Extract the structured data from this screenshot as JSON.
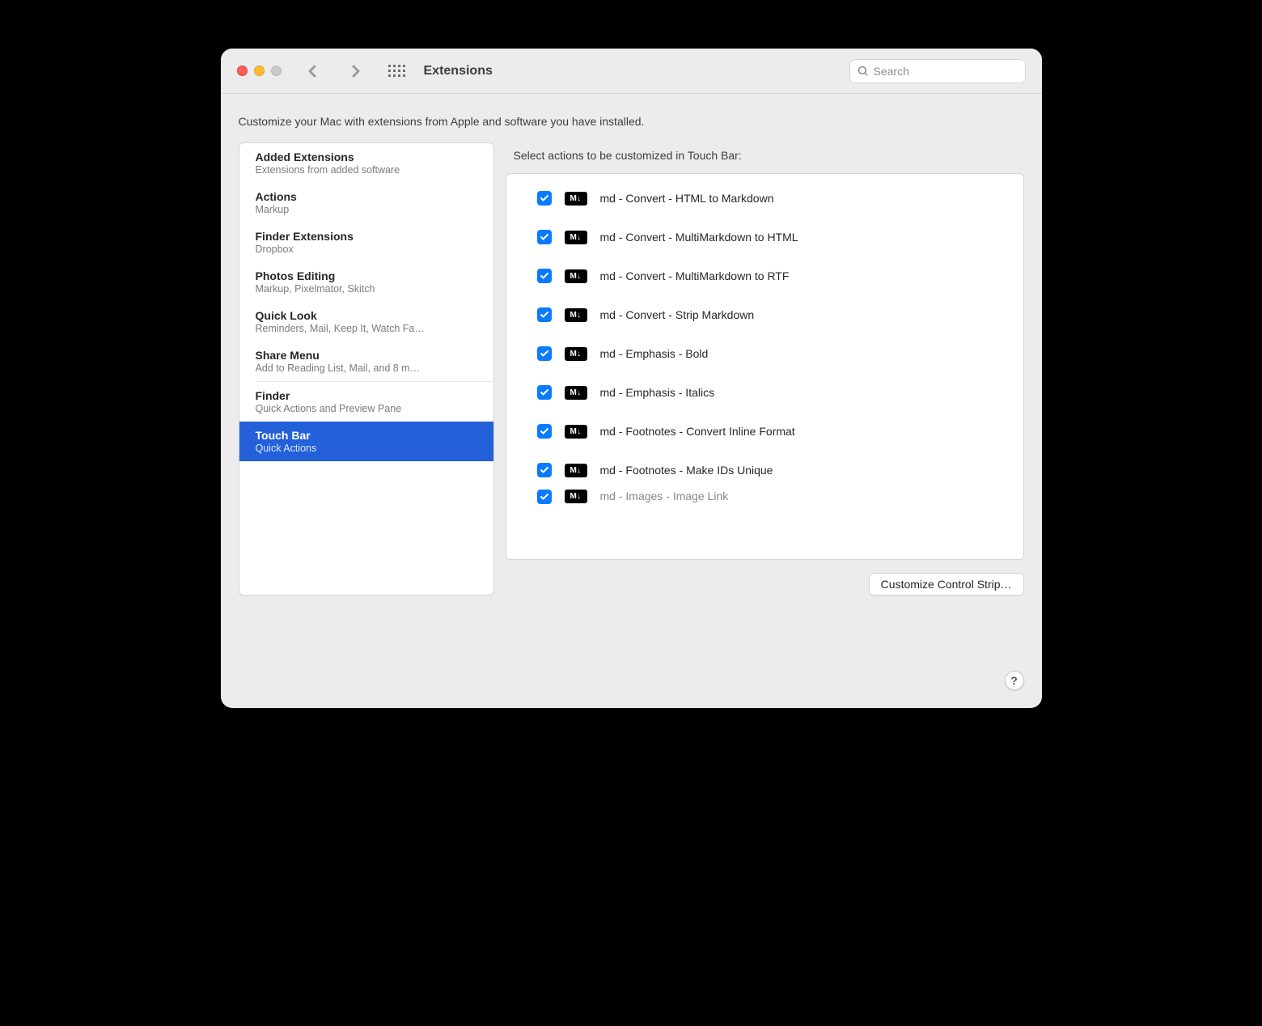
{
  "window": {
    "title": "Extensions"
  },
  "search": {
    "placeholder": "Search",
    "value": ""
  },
  "intro": "Customize your Mac with extensions from Apple and software you have installed.",
  "sidebar": {
    "items": [
      {
        "title": "Added Extensions",
        "subtitle": "Extensions from added software",
        "selected": false
      },
      {
        "title": "Actions",
        "subtitle": "Markup",
        "selected": false
      },
      {
        "title": "Finder Extensions",
        "subtitle": "Dropbox",
        "selected": false
      },
      {
        "title": "Photos Editing",
        "subtitle": "Markup, Pixelmator, Skitch",
        "selected": false
      },
      {
        "title": "Quick Look",
        "subtitle": "Reminders, Mail, Keep It, Watch Fa…",
        "selected": false
      },
      {
        "title": "Share Menu",
        "subtitle": "Add to Reading List, Mail, and 8 m…",
        "selected": false
      },
      {
        "title": "Finder",
        "subtitle": "Quick Actions and Preview Pane",
        "selected": false
      },
      {
        "title": "Touch Bar",
        "subtitle": "Quick Actions",
        "selected": true
      }
    ]
  },
  "main": {
    "header": "Select actions to be customized in Touch Bar:",
    "actions": [
      {
        "checked": true,
        "label": "md - Convert - HTML to Markdown"
      },
      {
        "checked": true,
        "label": "md - Convert - MultiMarkdown to HTML"
      },
      {
        "checked": true,
        "label": "md - Convert - MultiMarkdown to RTF"
      },
      {
        "checked": true,
        "label": "md - Convert - Strip Markdown"
      },
      {
        "checked": true,
        "label": "md - Emphasis - Bold"
      },
      {
        "checked": true,
        "label": "md - Emphasis - Italics"
      },
      {
        "checked": true,
        "label": "md - Footnotes - Convert Inline Format"
      },
      {
        "checked": true,
        "label": "md - Footnotes - Make IDs Unique"
      },
      {
        "checked": true,
        "label": "md - Images - Image Link",
        "partial": true
      }
    ],
    "customize_button": "Customize Control Strip…"
  },
  "help_label": "?"
}
